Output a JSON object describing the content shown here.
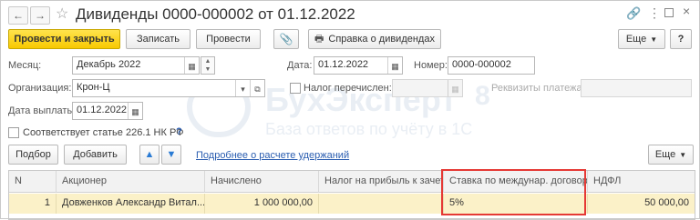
{
  "title": "Дивиденды 0000-000002 от 01.12.2022",
  "toolbar": {
    "post_close": "Провести и закрыть",
    "save": "Записать",
    "post": "Провести",
    "dividends_report": "Справка о дивидендах",
    "more": "Еще",
    "help": "?"
  },
  "form": {
    "month_label": "Месяц:",
    "month_value": "Декабрь 2022",
    "date_label": "Дата:",
    "date_value": "01.12.2022",
    "number_label": "Номер:",
    "number_value": "0000-000002",
    "org_label": "Организация:",
    "org_value": "Крон-Ц",
    "tax_transferred_label": "Налог перечислен:",
    "payment_details_label": "Реквизиты платежа:",
    "pay_date_label": "Дата выплаты:",
    "pay_date_value": "01.12.2022",
    "article_label": "Соответствует статье 226.1 НК РФ",
    "help_mark": "?"
  },
  "table_toolbar": {
    "select": "Подбор",
    "add": "Добавить",
    "details_link": "Подробнее о расчете удержаний",
    "more": "Еще"
  },
  "table": {
    "columns": [
      "N",
      "Акционер",
      "Начислено",
      "Налог на прибыль к зачету",
      "Ставка по междунар. договору",
      "НДФЛ"
    ],
    "rows": [
      [
        "1",
        "Довженков Александр Витал...",
        "1 000 000,00",
        "",
        "5%",
        "50 000,00"
      ]
    ]
  },
  "watermark": {
    "brand": "БухЭксперт",
    "digit": "8",
    "tagline": "База ответов по учёту в 1С"
  },
  "colors": {
    "primary_button": "#f8c900",
    "row_selected": "#fbf1c8",
    "highlight": "#e53935",
    "link": "#2a5db0"
  }
}
